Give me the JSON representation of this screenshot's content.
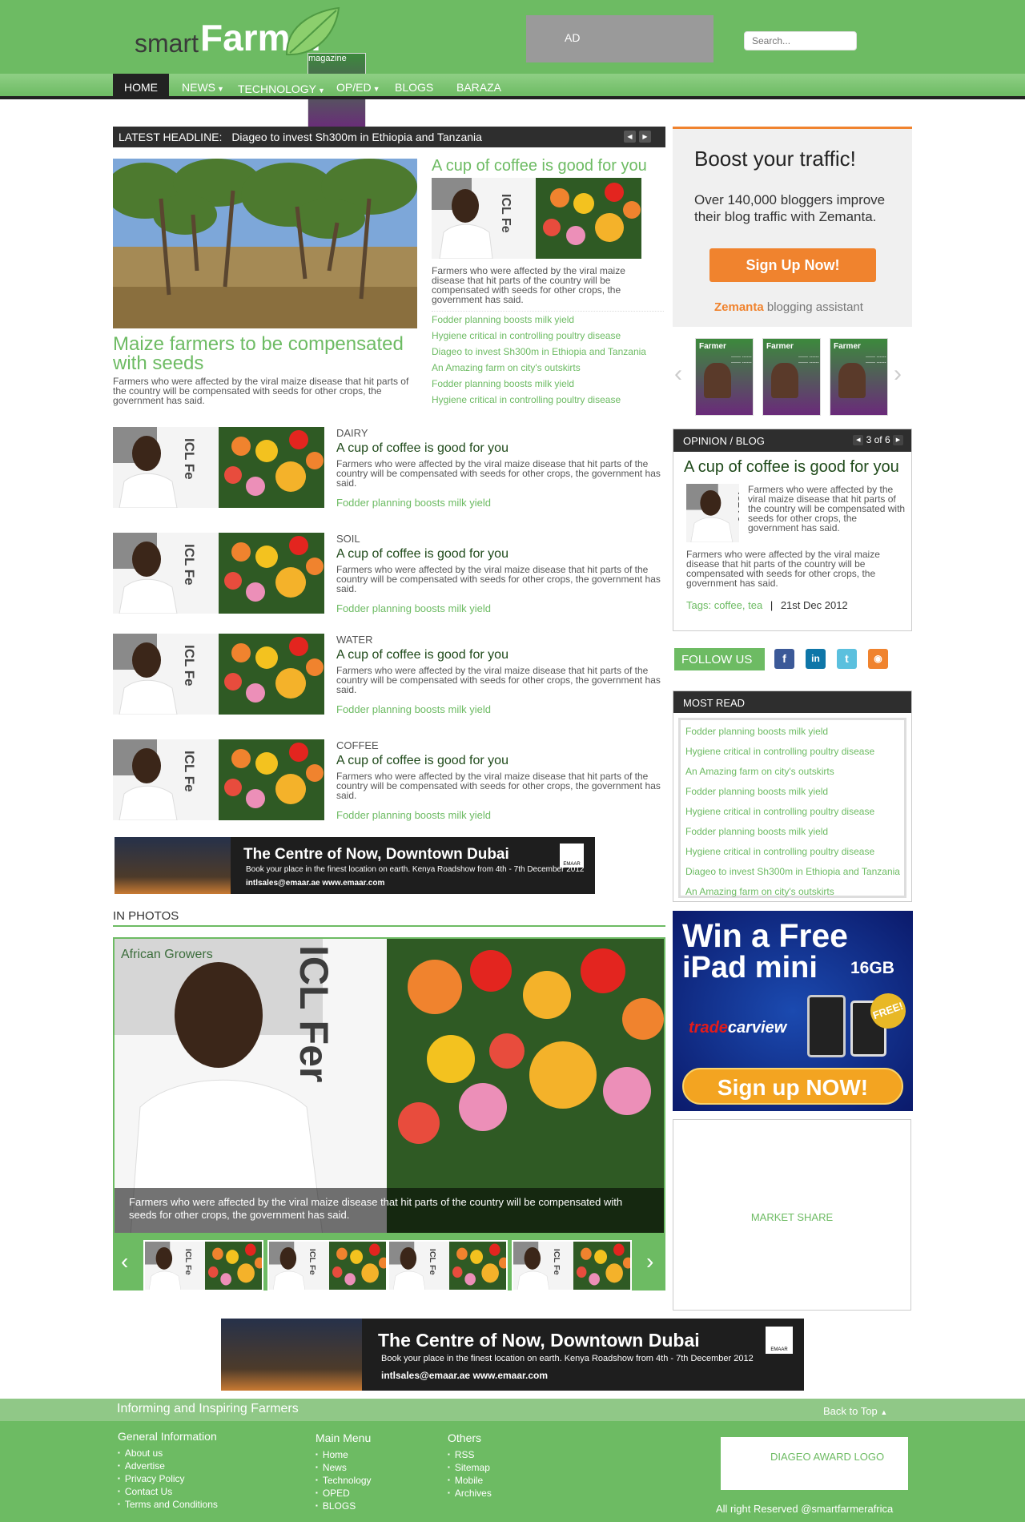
{
  "header": {
    "logo_smart": "smart",
    "logo_farmer": "Farmer",
    "logo_magazine": "magazine",
    "ad_label": "AD",
    "search_placeholder": "Search..."
  },
  "nav": {
    "items": [
      {
        "label": "HOME",
        "active": true
      },
      {
        "label": "NEWS",
        "dropdown": true
      },
      {
        "label": "TECHNOLOGY",
        "dropdown": true
      },
      {
        "label": "OP/ED",
        "dropdown": true
      },
      {
        "label": "BLOGS"
      },
      {
        "label": "BARAZA"
      }
    ]
  },
  "latest": {
    "label": "LATEST HEADLINE:",
    "headline": "Diageo to invest Sh300m in Ethiopia and Tanzania"
  },
  "featured": {
    "title": "Maize farmers to be compensated with seeds",
    "desc": "Farmers who were affected by the viral maize disease that hit parts of the country will be compensated with seeds for other crops, the government has said."
  },
  "secondary": {
    "title": "A cup of coffee is good for you",
    "desc": "Farmers who were affected by the viral maize disease that hit parts of the country will be compensated with seeds for other crops, the government has said.",
    "links": [
      "Fodder planning boosts milk yield",
      "Hygiene critical in controlling poultry disease",
      "Diageo to invest Sh300m in Ethiopia and Tanzania",
      "An Amazing farm on city's outskirts",
      "Fodder planning boosts milk yield",
      "Hygiene critical in controlling poultry disease"
    ]
  },
  "categories": [
    {
      "cat": "DAIRY",
      "title": "A cup of coffee is good for you",
      "desc": "Farmers who were affected by the viral maize disease that hit parts of the country will be compensated with seeds for other crops, the government has said.",
      "link": "Fodder planning boosts milk yield"
    },
    {
      "cat": "SOIL",
      "title": "A cup of coffee is good for you",
      "desc": "Farmers who were affected by the viral maize disease that hit parts of the country will be compensated with seeds for other crops, the government has said.",
      "link": "Fodder planning boosts milk yield"
    },
    {
      "cat": "WATER",
      "title": "A cup of coffee is good for you",
      "desc": "Farmers who were affected by the viral maize disease that hit parts of the country will be compensated with seeds for other crops, the government has said.",
      "link": "Fodder planning boosts milk yield"
    },
    {
      "cat": "COFFEE",
      "title": "A cup of coffee is good for you",
      "desc": "Farmers who were affected by the viral maize disease that hit parts of the country will be compensated with seeds for other crops, the government has said.",
      "link": "Fodder planning boosts milk yield"
    }
  ],
  "banner": {
    "title": "The Centre of Now, Downtown Dubai",
    "sub": "Book your place in the finest location on earth. Kenya Roadshow from 4th - 7th December 2012",
    "contact": "intlsales@emaar.ae  www.emaar.com",
    "brand": "EMAAR"
  },
  "photos": {
    "heading": "IN PHOTOS",
    "sign_text": "African Growers",
    "caption": "Farmers who were affected by the viral maize disease that hit parts of the country will be compensated with seeds for other crops, the government has said."
  },
  "zemanta": {
    "heading": "Boost your traffic!",
    "text": "Over 140,000 bloggers improve their blog traffic with Zemanta.",
    "button": "Sign Up Now!",
    "brand": "Zemanta",
    "brand_suffix": "blogging assistant"
  },
  "magazines": {
    "title": "Farmer"
  },
  "opinion": {
    "header": "OPINION / BLOG",
    "pager": "3 of 6",
    "title": "A cup of coffee is good for you",
    "desc1": "Farmers who were affected by the viral maize disease that hit parts of the country will be compensated with seeds for other crops, the government  has said.",
    "desc2": "Farmers who were affected by the viral maize disease that hit parts of the country will be compensated with seeds for other crops, the government has said.",
    "tags_label": "Tags:",
    "tags": "coffee, tea",
    "date": "21st Dec 2012"
  },
  "follow": {
    "label": "FOLLOW US",
    "colors": {
      "facebook": "#3b5998",
      "linkedin": "#0e76a8",
      "twitter": "#5bc0de",
      "rss": "#f0832e"
    }
  },
  "most_read": {
    "header": "MOST READ",
    "items": [
      "Fodder planning boosts milk yield",
      "Hygiene critical in controlling poultry disease",
      "An Amazing farm on city's outskirts",
      "Fodder planning boosts milk yield",
      "Hygiene critical in controlling poultry disease",
      "Fodder planning boosts milk yield",
      "Hygiene critical in controlling poultry disease",
      "Diageo to invest Sh300m in Ethiopia and Tanzania",
      "An Amazing farm on city's outskirts"
    ]
  },
  "ipad_ad": {
    "line1": "Win a Free",
    "line2": "iPad mini",
    "size": "16GB",
    "brand_a": "trade",
    "brand_b": "carview",
    "free": "FREE!",
    "button": "Sign up NOW!"
  },
  "market_share": "MARKET SHARE",
  "footer": {
    "tagline": "Informing and Inspiring Farmers",
    "back_to_top": "Back to Top",
    "general": {
      "heading": "General Information",
      "items": [
        "About us",
        "Advertise",
        "Privacy Policy",
        "Contact Us",
        "Terms and Conditions"
      ]
    },
    "main": {
      "heading": "Main Menu",
      "items": [
        "Home",
        "News",
        "Technology",
        "OPED",
        "BLOGS"
      ]
    },
    "others": {
      "heading": "Others",
      "items": [
        "RSS",
        "Sitemap",
        "Mobile",
        "Archives"
      ]
    },
    "award": "DIAGEO AWARD LOGO",
    "rights": "All right Reserved @smartfarmerafrica"
  },
  "colors": {
    "brand_green": "#6dbb63",
    "dark": "#2e2e2e",
    "orange": "#f0832e"
  }
}
